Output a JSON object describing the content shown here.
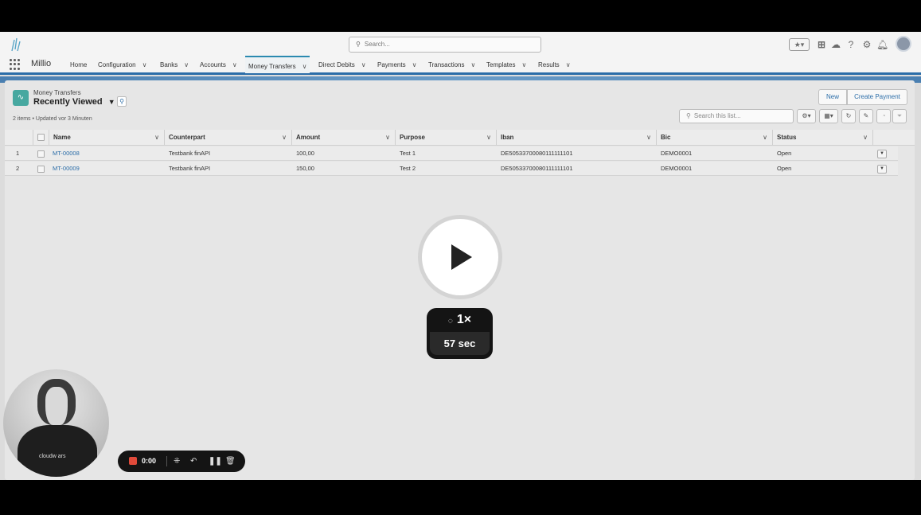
{
  "header": {
    "search_placeholder": "Search...",
    "app_name": "Millio"
  },
  "nav": {
    "items": [
      {
        "label": "Home"
      },
      {
        "label": "Configuration"
      },
      {
        "label": "Banks"
      },
      {
        "label": "Accounts"
      },
      {
        "label": "Money Transfers"
      },
      {
        "label": "Direct Debits"
      },
      {
        "label": "Payments"
      },
      {
        "label": "Transactions"
      },
      {
        "label": "Templates"
      },
      {
        "label": "Results"
      }
    ],
    "active": "Money Transfers"
  },
  "list": {
    "object_label": "Money Transfers",
    "view_name": "Recently Viewed",
    "meta": "2 items • Updated vor 3 Minuten",
    "new_label": "New",
    "create_payment_label": "Create Payment",
    "search_placeholder": "Search this list...",
    "columns": [
      "Name",
      "Counterpart",
      "Amount",
      "Purpose",
      "Iban",
      "Bic",
      "Status"
    ],
    "rows": [
      {
        "num": "1",
        "name": "MT-00008",
        "counterpart": "Testbank finAPI",
        "amount": "100,00",
        "purpose": "Test 1",
        "iban": "DE50533700080111111101",
        "bic": "DEMO0001",
        "status": "Open"
      },
      {
        "num": "2",
        "name": "MT-00009",
        "counterpart": "Testbank finAPI",
        "amount": "150,00",
        "purpose": "Test 2",
        "iban": "DE50533700080111111101",
        "bic": "DEMO0001",
        "status": "Open"
      }
    ]
  },
  "player": {
    "speed": "1×",
    "duration": "57 sec",
    "rec_time": "0:00",
    "cam_text": "cloudw  ars"
  },
  "colors": {
    "accent": "#2b6da8",
    "object_icon": "#47a8a0",
    "record": "#e04a3a"
  }
}
